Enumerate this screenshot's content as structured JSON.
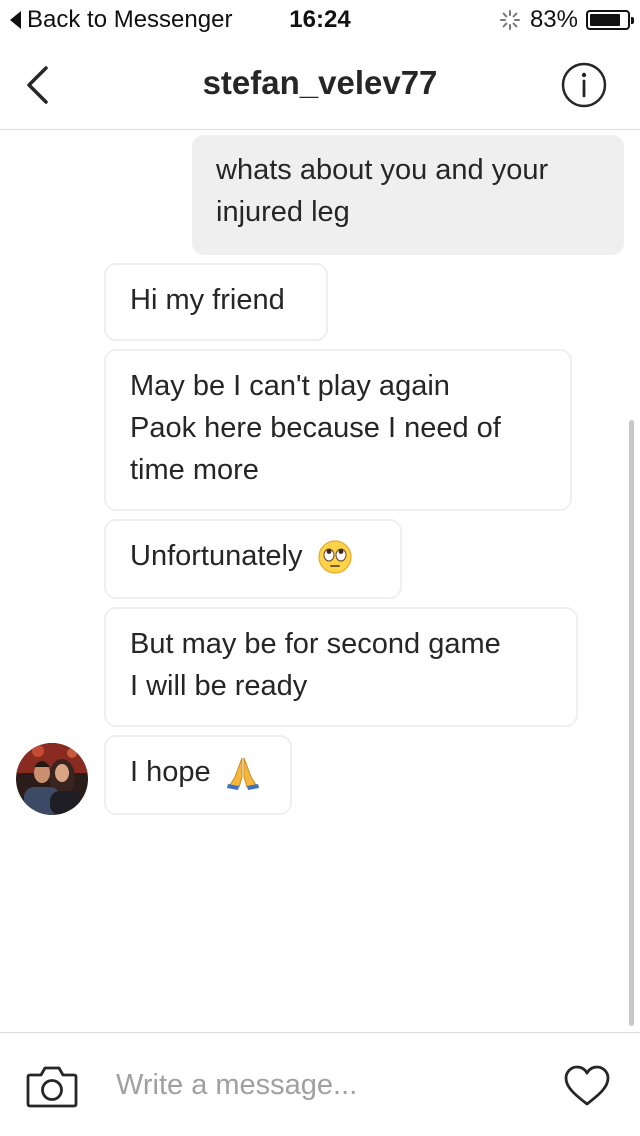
{
  "status_bar": {
    "back_label": "Back to Messenger",
    "time": "16:24",
    "battery_percent": "83%",
    "battery_level": 0.83
  },
  "header": {
    "title": "stefan_velev77",
    "back_icon": "chevron-left-icon",
    "info_icon": "info-icon"
  },
  "messages": [
    {
      "direction": "outgoing",
      "lines": [
        "whats about you and your",
        "injured leg"
      ]
    },
    {
      "direction": "incoming",
      "lines": [
        "Hi my friend"
      ]
    },
    {
      "direction": "incoming",
      "lines": [
        "May be I can't play again",
        "Paok here because I need of",
        "time more"
      ]
    },
    {
      "direction": "incoming",
      "lines": [
        "Unfortunately"
      ],
      "emoji": "rolling-eyes-emoji"
    },
    {
      "direction": "incoming",
      "lines": [
        "But may be for second game",
        "I will be ready"
      ]
    },
    {
      "direction": "incoming",
      "lines": [
        "I hope"
      ],
      "emoji": "folded-hands-emoji"
    }
  ],
  "composer": {
    "placeholder": "Write a message...",
    "camera_icon": "camera-icon",
    "heart_icon": "heart-icon"
  }
}
